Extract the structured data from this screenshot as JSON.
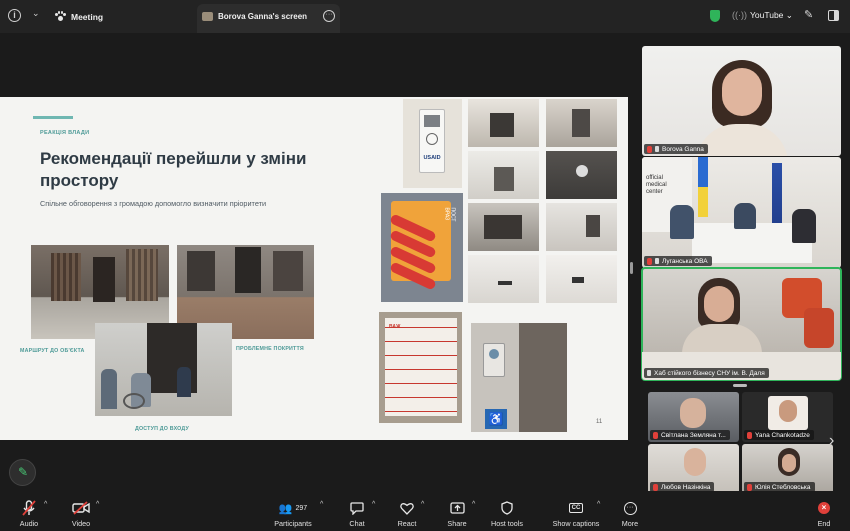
{
  "topbar": {
    "meeting_label": "Meeting",
    "screen_tab_label": "Borova Ganna's screen",
    "stream_label": "YouTube",
    "icons": [
      "info-icon",
      "chevron-down-icon",
      "paw-icon",
      "more-icon",
      "shield-icon",
      "live-icon",
      "pen-icon",
      "layout-icon"
    ]
  },
  "slide": {
    "tag": "РЕАКЦІЯ ВЛАДИ",
    "title": "Рекомендації перейшли у зміни простору",
    "subtitle": "Спільне обговорення з громадою допомогло визначити пріоритети",
    "captions": {
      "route": "МАРШРУТ ДО ОБ'ЄКТА",
      "surface": "ПРОБЛЕМНЕ ПОКРИТТЯ",
      "access": "ДОСТУП ДО ВХОДУ"
    },
    "page_number": "11",
    "usaid_box": "USAID",
    "post_label": "ПОСТ ВРАЗ",
    "poster_text": "ВАЖ"
  },
  "participants": {
    "speakers": [
      {
        "name": "Borova Ganna"
      },
      {
        "name": "Луганська ОВА"
      },
      {
        "name": "Хаб стійкого бізнесу СНУ ім. В. Даля"
      }
    ],
    "gallery": [
      {
        "name": "Світлана  Земляна т..."
      },
      {
        "name": "Yana Chankotadze"
      },
      {
        "name": "Любов Назінкіна"
      },
      {
        "name": "Юлія Стебловська"
      }
    ],
    "office_sign": "official medical center"
  },
  "toolbar": {
    "audio": "Audio",
    "video": "Video",
    "participants": "Participants",
    "participants_count": "297",
    "chat": "Chat",
    "react": "React",
    "share": "Share",
    "host_tools": "Host tools",
    "captions": "Show captions",
    "more": "More",
    "end": "End"
  },
  "colors": {
    "accent_teal": "#4d9a97",
    "title_dark": "#2f3b45",
    "active_speaker": "#2fb45a",
    "end_red": "#e0403a"
  }
}
